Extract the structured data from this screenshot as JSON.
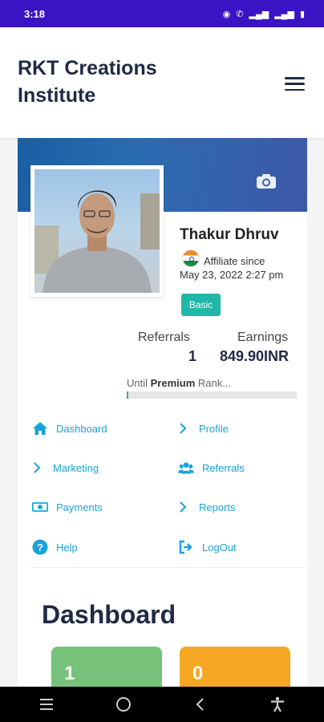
{
  "status_bar": {
    "time": "3:18"
  },
  "header": {
    "brand": "RKT Creations Institute"
  },
  "profile": {
    "name": "Thakur Dhruv",
    "affiliate_since_label": "Affiliate since",
    "affiliate_since_date": "May 23, 2022 2:27 pm",
    "rank_badge": "Basic",
    "referrals_label": "Referrals",
    "referrals_value": "1",
    "earnings_label": "Earnings",
    "earnings_value": "849.90INR",
    "progress_prefix": "Until ",
    "progress_rank": "Premium",
    "progress_suffix": " Rank...",
    "progress_fraction": 0.01
  },
  "menu": {
    "dashboard": "Dashboard",
    "profile": "Profile",
    "marketing": "Marketing",
    "referrals": "Referrals",
    "payments": "Payments",
    "reports": "Reports",
    "help": "Help",
    "logout": "LogOut"
  },
  "dashboard": {
    "title": "Dashboard",
    "card_1_value": "1",
    "card_2_value": "0"
  },
  "colors": {
    "status_bar": "#3a13c4",
    "accent": "#1aa3d8",
    "badge": "#20b8a8",
    "card_green": "#77c27a",
    "card_orange": "#f5a623"
  }
}
